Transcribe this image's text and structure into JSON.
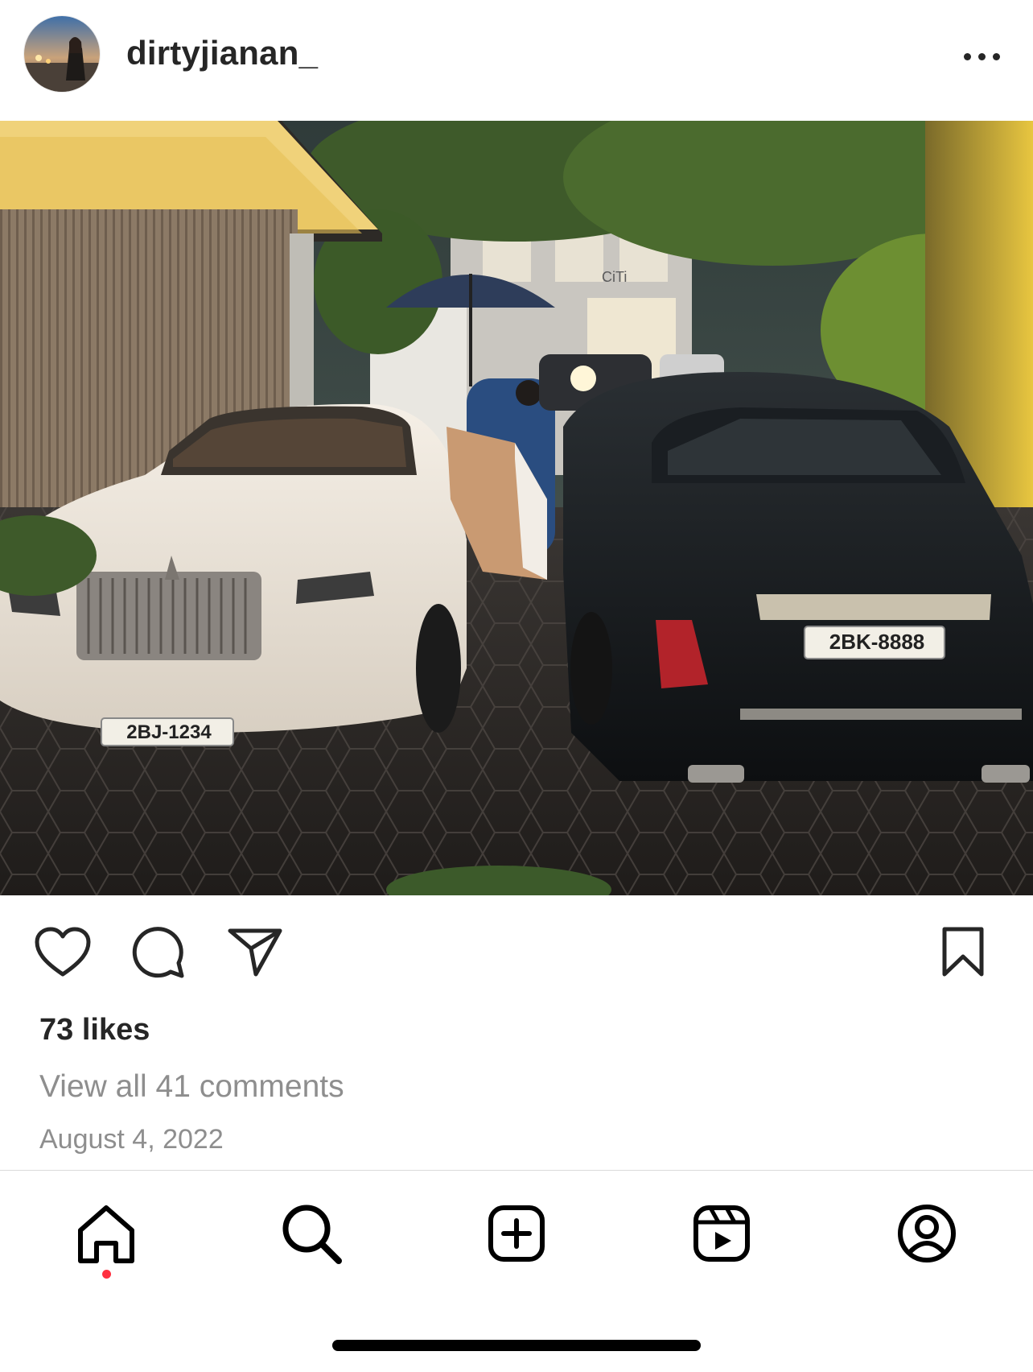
{
  "post": {
    "username": "dirtyjianan_",
    "likes": "73 likes",
    "comments_link": "View all 41 comments",
    "date": "August 4, 2022"
  },
  "photo": {
    "plate_white_car": "2BJ-1234",
    "plate_black_car": "2BK-8888",
    "storefront_sign": "CiTi"
  },
  "icons": {
    "more": "more-options-icon",
    "like": "heart-icon",
    "comment": "comment-bubble-icon",
    "share": "paper-plane-icon",
    "save": "bookmark-icon",
    "home": "home-icon",
    "search": "search-icon",
    "create": "plus-square-icon",
    "reels": "reels-icon",
    "profile": "profile-icon"
  },
  "colors": {
    "text": "#262626",
    "muted": "#8e8e8e",
    "notification": "#ff3040",
    "divider": "#dbdbdb"
  }
}
